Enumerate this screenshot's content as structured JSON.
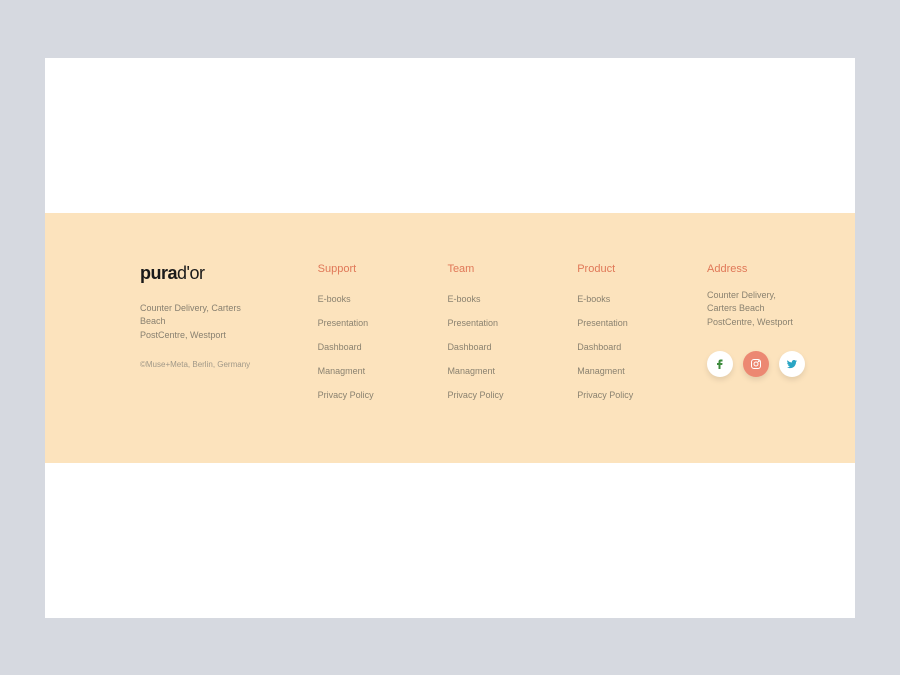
{
  "brand": {
    "logo_part1": "pura",
    "logo_part2": "d'or",
    "address_line1": "Counter Delivery, Carters Beach",
    "address_line2": "PostCentre, Westport",
    "copyright": "©Muse+Meta, Berlin, Germany"
  },
  "columns": {
    "support": {
      "title": "Support",
      "links": [
        "E-books",
        "Presentation",
        "Dashboard",
        "Managment",
        "Privacy Policy"
      ]
    },
    "team": {
      "title": "Team",
      "links": [
        "E-books",
        "Presentation",
        "Dashboard",
        "Managment",
        "Privacy Policy"
      ]
    },
    "product": {
      "title": "Product",
      "links": [
        "E-books",
        "Presentation",
        "Dashboard",
        "Managment",
        "Privacy Policy"
      ]
    }
  },
  "address": {
    "title": "Address",
    "line1": "Counter Delivery, Carters Beach",
    "line2": "PostCentre, Westport"
  },
  "colors": {
    "accent": "#e07858",
    "footer_bg": "#fce3bd",
    "social_active": "#ec8872",
    "icon_green": "#3d8b3d",
    "icon_teal": "#2aa5c4"
  }
}
